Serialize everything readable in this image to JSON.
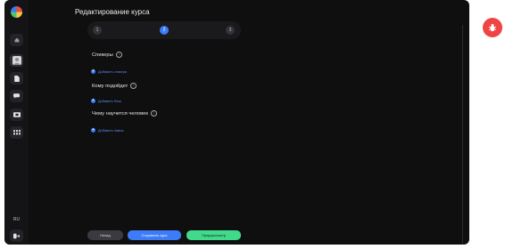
{
  "page": {
    "title": "Редактирование курса"
  },
  "stepper": {
    "steps": [
      "1",
      "2",
      "3"
    ],
    "active_index": 1
  },
  "sections": [
    {
      "label": "Спикеры",
      "add_label": "Добавить спикера"
    },
    {
      "label": "Кому подойдет",
      "add_label": "Добавить блок"
    },
    {
      "label": "Чему научится человек",
      "add_label": "Добавить навык"
    }
  ],
  "sidebar": {
    "language": "RU",
    "icons": [
      "home-icon",
      "avatar",
      "document-icon",
      "chat-icon",
      "video-icon",
      "grid-icon",
      "logout-icon"
    ]
  },
  "footer": {
    "back_label": "Назад",
    "save_label": "Сохранить курс",
    "preview_label": "Предпросмотр"
  },
  "colors": {
    "accent": "#3d7bf7",
    "success": "#41d98a",
    "danger": "#ef4444",
    "background": "#0f0f10"
  }
}
